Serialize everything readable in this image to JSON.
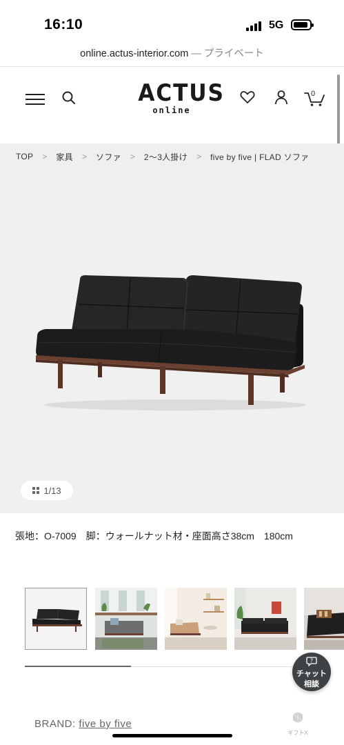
{
  "status_bar": {
    "time": "16:10",
    "network": "5G"
  },
  "browser": {
    "domain": "online.actus-interior.com",
    "private_label": "— プライベート"
  },
  "header": {
    "logo_text": "ACTUS",
    "logo_sub": "online",
    "cart_count": "0",
    "icons": [
      "menu-icon",
      "search-icon",
      "heart-icon",
      "user-icon",
      "cart-icon"
    ]
  },
  "breadcrumb": {
    "separator": ">",
    "items": [
      "TOP",
      "家具",
      "ソファ",
      "2〜3人掛け",
      "five by five | FLAD ソファ"
    ]
  },
  "gallery": {
    "counter": "1/13",
    "current": 1,
    "total": 13
  },
  "spec_text": "張地：O-7009　脚：ウォールナット材・座面高さ38cm　180cm",
  "chat_button": {
    "line1": "チャット",
    "line2": "相談"
  },
  "brand": {
    "label": "BRAND: ",
    "name": "five by five"
  },
  "gift_label": "ギフトX",
  "colors": {
    "leather": "#1e1e1e",
    "walnut": "#6b4030",
    "gallery_bg": "#f0f0f0",
    "breadcrumb_bg": "#eef0ef",
    "chat_bg": "#3f4245"
  }
}
